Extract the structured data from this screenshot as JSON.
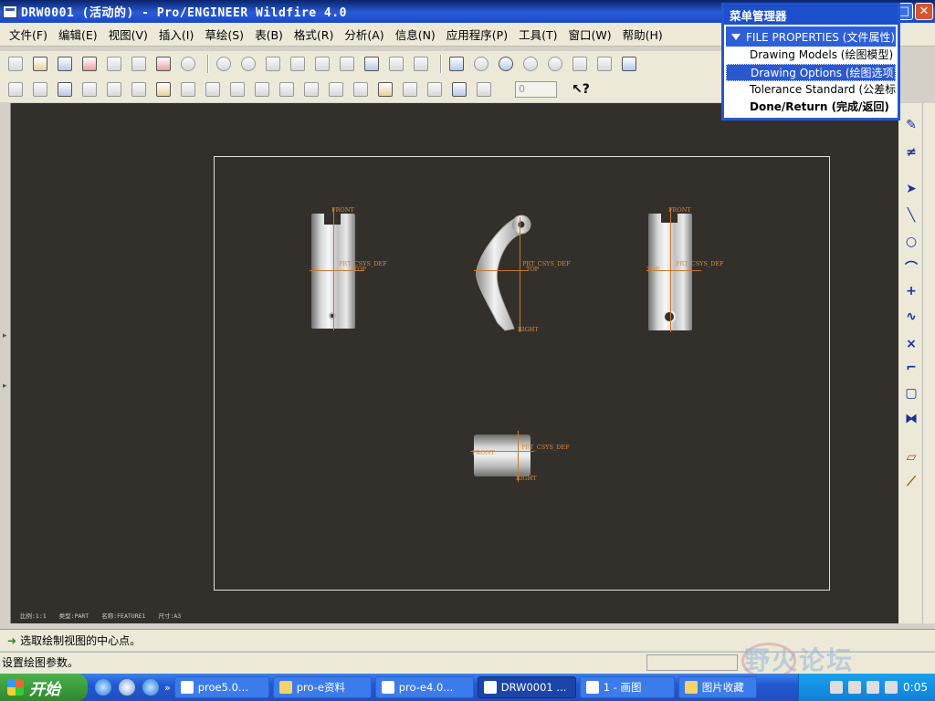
{
  "window": {
    "title": "DRW0001 (活动的) - Pro/ENGINEER Wildfire 4.0"
  },
  "menubar": [
    "文件(F)",
    "编辑(E)",
    "视图(V)",
    "插入(I)",
    "草绘(S)",
    "表(B)",
    "格式(R)",
    "分析(A)",
    "信息(N)",
    "应用程序(P)",
    "工具(T)",
    "窗口(W)",
    "帮助(H)"
  ],
  "toolbar2": {
    "spin_value": "0"
  },
  "menu_manager": {
    "title": "菜单管理器",
    "submenu": "FILE PROPERTIES (文件属性)",
    "items": [
      {
        "label": "Drawing Models (绘图模型)"
      },
      {
        "label": "Drawing Options (绘图选项)"
      },
      {
        "label": "Tolerance Standard (公差标准)"
      },
      {
        "label": "Done/Return (完成/返回)"
      }
    ]
  },
  "views": {
    "front": {
      "top_label": "FRONT",
      "csys_label": "PRT_CSYS_DEF",
      "side_label": "TOP"
    },
    "center": {
      "csys_label": "PRT_CSYS_DEF",
      "side_label": "TOP",
      "bottom_label": "RIGHT"
    },
    "right": {
      "top_label": "FRONT",
      "csys_label": "PRT_CSYS_DEF",
      "side_label": "TOP"
    },
    "bottom": {
      "csys_label": "PRT_CSYS_DEF",
      "side_label": "FRONT",
      "bottom_label": "RIGHT"
    }
  },
  "canvas_status": {
    "scale": "比例:1:1",
    "type": "类型:PART",
    "name": "名称:FEATURE1",
    "size": "尺寸:A3"
  },
  "prompt": {
    "message": "选取绘制视图的中心点。",
    "status": "设置绘图参数。"
  },
  "watermark": "野火论坛",
  "taskbar": {
    "start": "开始",
    "buttons": [
      {
        "label": "proe5.0..."
      },
      {
        "label": "pro-e资料"
      },
      {
        "label": "pro-e4.0..."
      },
      {
        "label": "DRW0001 ..."
      },
      {
        "label": "1 - 画图"
      },
      {
        "label": "图片收藏"
      }
    ],
    "clock": "0:05"
  },
  "colors": {
    "title_bar": "#0a246a",
    "canvas": "#33302b",
    "datum": "#c8782c",
    "menu_highlight": "#2a59cf"
  }
}
